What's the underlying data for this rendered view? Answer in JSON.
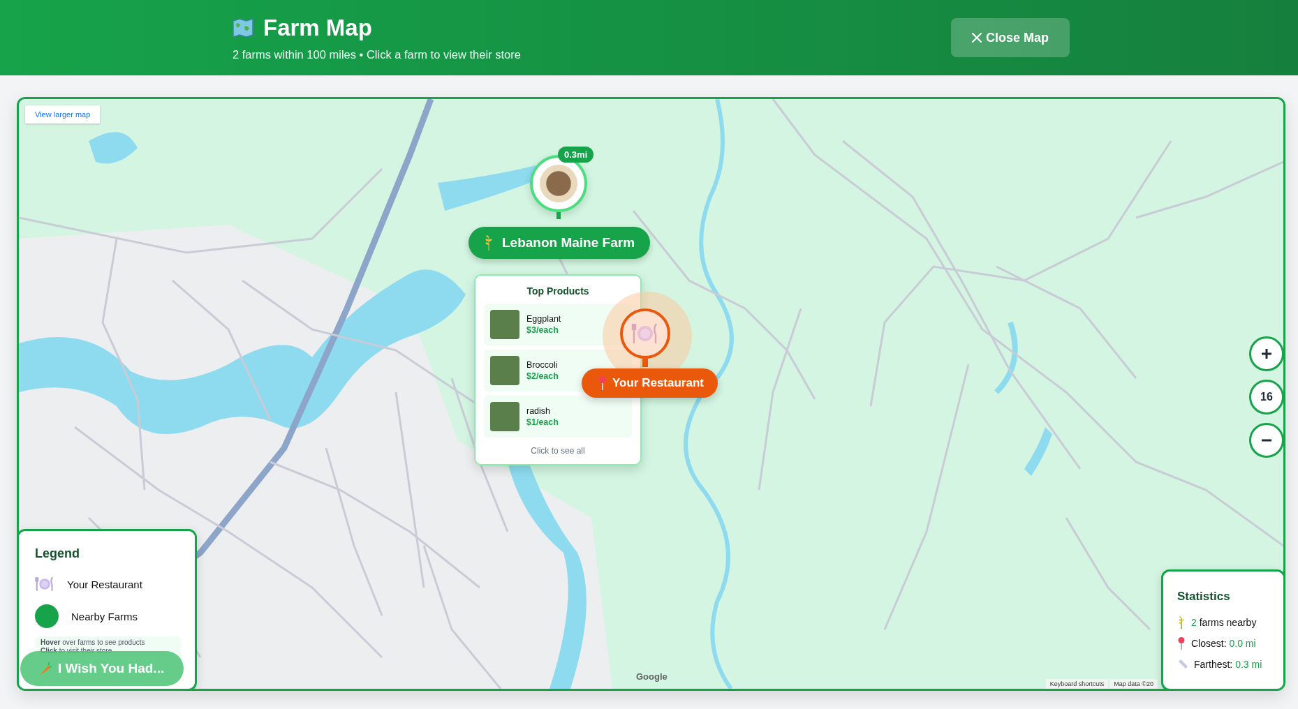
{
  "header": {
    "title": "Farm Map",
    "subtitle": "2 farms within 100 miles • Click a farm to view their store",
    "close_button": "Close Map"
  },
  "map": {
    "view_larger_link": "View larger map",
    "zoom_level": "16",
    "farm_marker": {
      "distance": "0.3mi",
      "name": "Lebanon Maine Farm"
    },
    "products_popup": {
      "title": "Top Products",
      "footer": "Click to see all",
      "products": [
        {
          "name": "Eggplant",
          "price": "$3/each"
        },
        {
          "name": "Broccoli",
          "price": "$2/each"
        },
        {
          "name": "radish",
          "price": "$1/each"
        }
      ]
    },
    "restaurant_marker": {
      "label": "Your Restaurant"
    },
    "attribution": {
      "logo": "Google",
      "keyboard_shortcuts": "Keyboard shortcuts",
      "map_data": "Map data ©20"
    }
  },
  "legend": {
    "title": "Legend",
    "items": [
      {
        "kind": "restaurant",
        "label": "Your Restaurant"
      },
      {
        "kind": "farm",
        "label": "Nearby Farms"
      }
    ],
    "hints": [
      "**Hover** over farms to see products",
      "**Click** to visit their store"
    ]
  },
  "wish_button": "I Wish You Had...",
  "statistics": {
    "title": "Statistics",
    "rows": [
      {
        "kind": "farms",
        "value": "2",
        "label": "farms nearby"
      },
      {
        "kind": "closest",
        "label": "Closest:",
        "value": "0.0 mi"
      },
      {
        "kind": "farthest",
        "label": "Farthest:",
        "value": "0.3 mi"
      }
    ]
  }
}
